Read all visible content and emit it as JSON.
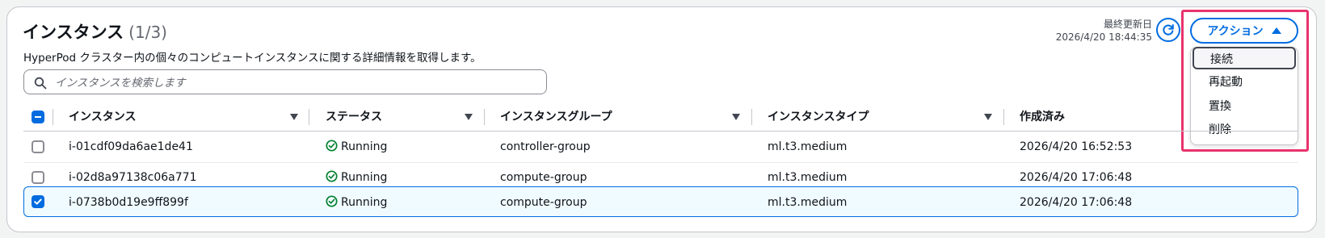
{
  "header": {
    "title": "インスタンス",
    "count": "(1/3)",
    "description": "HyperPod クラスター内の個々のコンピュートインスタンスに関する詳細情報を取得します。",
    "updated_label": "最終更新日",
    "updated_value": "2026/4/20 18:44:35"
  },
  "actions": {
    "button_label": "アクション",
    "menu_items": [
      "接続",
      "再起動",
      "置換",
      "削除"
    ],
    "focused_index": 0
  },
  "search": {
    "placeholder": "インスタンスを検索します",
    "value": ""
  },
  "table": {
    "columns": [
      "インスタンス",
      "ステータス",
      "インスタンスグループ",
      "インスタンスタイプ",
      "作成済み"
    ],
    "header_checkbox": "indeterminate",
    "rows": [
      {
        "selected": false,
        "instance": "i-01cdf09da6ae1de41",
        "status": "Running",
        "group": "controller-group",
        "type": "ml.t3.medium",
        "created": "2026/4/20 16:52:53"
      },
      {
        "selected": false,
        "instance": "i-02d8a97138c06a771",
        "status": "Running",
        "group": "compute-group",
        "type": "ml.t3.medium",
        "created": "2026/4/20 17:06:48"
      },
      {
        "selected": true,
        "instance": "i-0738b0d19e9ff899f",
        "status": "Running",
        "group": "compute-group",
        "type": "ml.t3.medium",
        "created": "2026/4/20 17:06:48"
      }
    ]
  },
  "icons": {
    "refresh": "refresh-icon",
    "search": "search-icon",
    "status_ok": "status-success-icon",
    "sort": "sort-caret-icon",
    "caret_up": "caret-up-icon"
  },
  "colors": {
    "primary": "#006ce0",
    "success": "#00802f",
    "highlight": "#e8336d",
    "border": "#c6c6cd"
  }
}
